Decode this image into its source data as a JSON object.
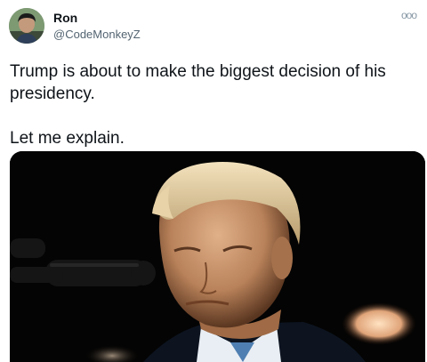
{
  "tweet": {
    "author_name": "Ron",
    "author_handle": "@CodeMonkeyZ",
    "more_label": "ooo",
    "text_paragraphs": [
      "Trump is about to make the biggest decision of his presidency.",
      "Let me explain."
    ]
  },
  "icons": {
    "more": "more-options-icon",
    "avatar": "avatar"
  },
  "colors": {
    "text_primary": "#0f1419",
    "text_secondary": "#536471",
    "background": "#ffffff",
    "media_background": "#050505"
  }
}
